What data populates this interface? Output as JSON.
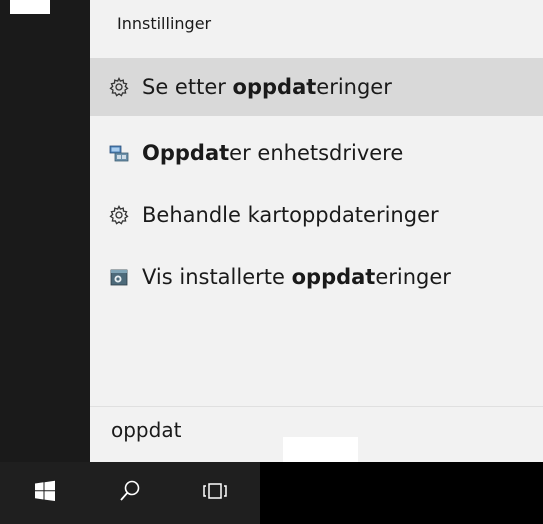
{
  "panel": {
    "section_header": "Innstillinger",
    "results": [
      {
        "pre": "Se etter ",
        "bold": "oppdat",
        "post": "eringer",
        "icon": "gear-icon"
      },
      {
        "pre": "",
        "bold": "Oppdat",
        "post": "er enhetsdrivere",
        "icon": "device-manager-icon"
      },
      {
        "pre": "Behandle kartoppdateringer",
        "bold": "",
        "post": "",
        "icon": "gear-icon"
      },
      {
        "pre": "Vis installerte ",
        "bold": "oppdat",
        "post": "eringer",
        "icon": "installed-updates-icon"
      }
    ]
  },
  "search": {
    "value": "oppdat"
  },
  "taskbar": {
    "start_icon": "windows-logo-icon",
    "search_icon": "search-icon",
    "taskview_icon": "task-view-icon"
  }
}
